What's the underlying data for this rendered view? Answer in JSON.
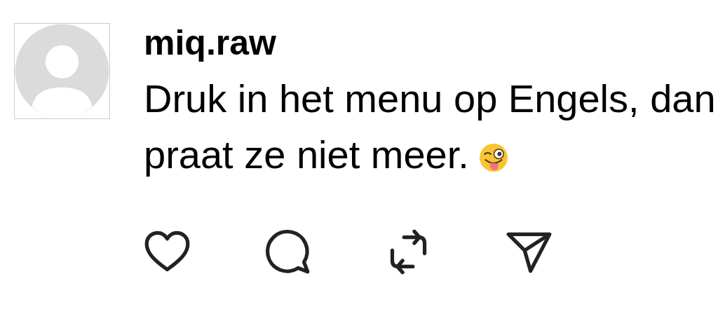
{
  "post": {
    "username": "miq.raw",
    "text_lines": [
      "Druk in het menu op Engels, dan",
      "praat ze niet meer."
    ]
  }
}
